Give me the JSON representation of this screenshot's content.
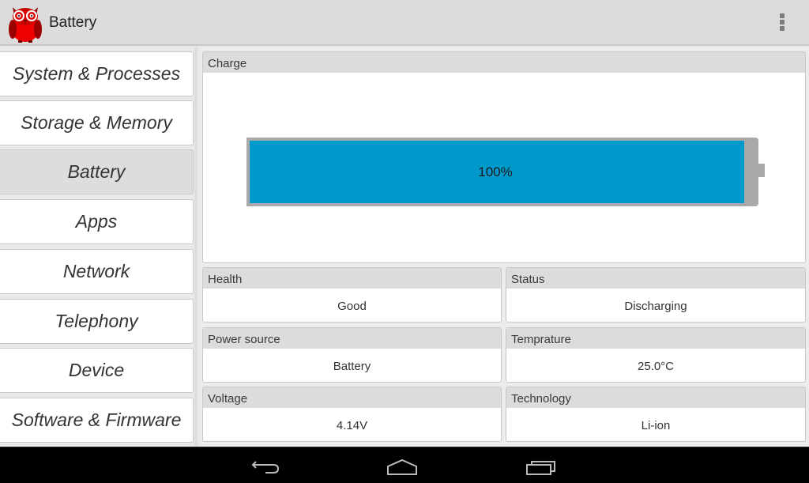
{
  "header": {
    "title": "Battery",
    "logo_icon": "owl-logo-icon",
    "menu_icon": "overflow-menu-icon"
  },
  "sidebar": {
    "items": [
      {
        "label": "System & Processes",
        "active": false
      },
      {
        "label": "Storage & Memory",
        "active": false
      },
      {
        "label": "Battery",
        "active": true
      },
      {
        "label": "Apps",
        "active": false
      },
      {
        "label": "Network",
        "active": false
      },
      {
        "label": "Telephony",
        "active": false
      },
      {
        "label": "Device",
        "active": false
      },
      {
        "label": "Software & Firmware",
        "active": false
      }
    ]
  },
  "charge": {
    "title": "Charge",
    "percent": 100,
    "label": "100%",
    "fill_color": "#0099cc"
  },
  "details": [
    {
      "title": "Health",
      "value": "Good"
    },
    {
      "title": "Status",
      "value": "Discharging"
    },
    {
      "title": "Power source",
      "value": "Battery"
    },
    {
      "title": "Temprature",
      "value": "25.0°C"
    },
    {
      "title": "Voltage",
      "value": "4.14V"
    },
    {
      "title": "Technology",
      "value": "Li-ion"
    }
  ],
  "navbar": {
    "back_icon": "back-icon",
    "home_icon": "home-icon",
    "recents_icon": "recent-apps-icon"
  }
}
